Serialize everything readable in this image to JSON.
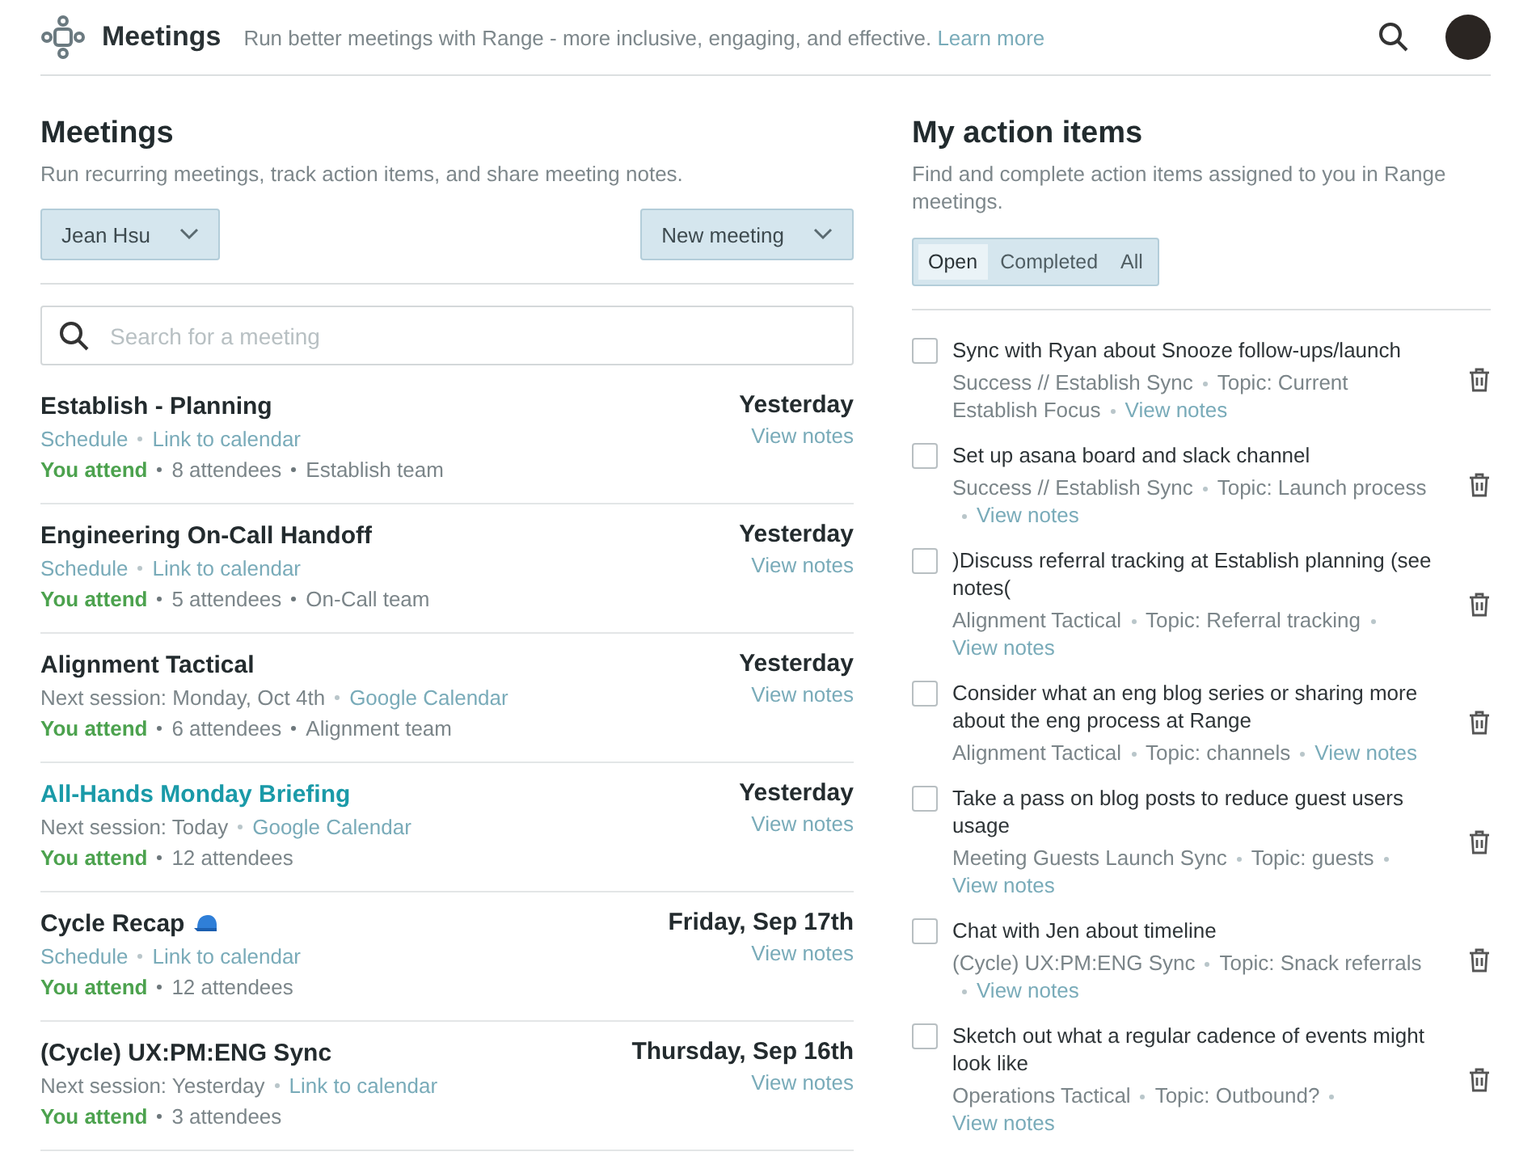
{
  "header": {
    "title": "Meetings",
    "tagline": "Run better meetings with Range - more inclusive, engaging, and effective.",
    "learn_more": "Learn more"
  },
  "meetings_panel": {
    "title": "Meetings",
    "subtitle": "Run recurring meetings, track action items, and share meeting notes.",
    "person_dropdown": "Jean Hsu",
    "new_meeting_dropdown": "New meeting",
    "search": {
      "placeholder": "Search for a meeting"
    },
    "meetings": [
      {
        "title": "Establish - Planning",
        "kind": "standard",
        "highlighted": false,
        "date": "Yesterday",
        "view_notes": "View notes",
        "schedule": [
          {
            "text": "Schedule",
            "kind": "link"
          },
          {
            "text": "Link to calendar",
            "kind": "link"
          }
        ],
        "attend": "You attend",
        "details": [
          "8 attendees",
          "Establish team"
        ]
      },
      {
        "title": "Engineering On-Call Handoff",
        "kind": "standard",
        "highlighted": false,
        "date": "Yesterday",
        "view_notes": "View notes",
        "schedule": [
          {
            "text": "Schedule",
            "kind": "link"
          },
          {
            "text": "Link to calendar",
            "kind": "link"
          }
        ],
        "attend": "You attend",
        "details": [
          "5 attendees",
          "On-Call team"
        ]
      },
      {
        "title": "Alignment Tactical",
        "kind": "standard",
        "highlighted": false,
        "date": "Yesterday",
        "view_notes": "View notes",
        "schedule": [
          {
            "text": "Next session: Monday, Oct 4th",
            "kind": "plain"
          },
          {
            "text": "Google Calendar",
            "kind": "link"
          }
        ],
        "attend": "You attend",
        "details": [
          "6 attendees",
          "Alignment team"
        ]
      },
      {
        "title": "All-Hands Monday Briefing",
        "kind": "standard",
        "highlighted": true,
        "date": "Yesterday",
        "view_notes": "View notes",
        "schedule": [
          {
            "text": "Next session: Today",
            "kind": "plain"
          },
          {
            "text": "Google Calendar",
            "kind": "link"
          }
        ],
        "attend": "You attend",
        "details": [
          "12 attendees"
        ]
      },
      {
        "title": "Cycle Recap",
        "kind": "with_cap",
        "highlighted": false,
        "date": "Friday, Sep 17th",
        "view_notes": "View notes",
        "schedule": [
          {
            "text": "Schedule",
            "kind": "link"
          },
          {
            "text": "Link to calendar",
            "kind": "link"
          }
        ],
        "attend": "You attend",
        "details": [
          "12 attendees"
        ]
      },
      {
        "title": "(Cycle) UX:PM:ENG Sync",
        "kind": "standard",
        "highlighted": false,
        "date": "Thursday, Sep 16th",
        "view_notes": "View notes",
        "schedule": [
          {
            "text": "Next session: Yesterday",
            "kind": "plain"
          },
          {
            "text": "Link to calendar",
            "kind": "link"
          }
        ],
        "attend": "You attend",
        "details": [
          "3 attendees"
        ]
      }
    ]
  },
  "action_items_panel": {
    "title": "My action items",
    "subtitle": "Find and complete action items assigned to you in Range meetings.",
    "tabs": [
      {
        "label": "Open",
        "selected": true
      },
      {
        "label": "Completed",
        "selected": false
      },
      {
        "label": "All",
        "selected": false
      }
    ],
    "items": [
      {
        "text": "Sync with Ryan about Snooze follow-ups/launch",
        "checked": false,
        "meeting": "Success // Establish Sync",
        "topic": "Topic: Current Establish Focus",
        "view_notes": "View notes"
      },
      {
        "text": "Set up asana board and slack channel",
        "checked": false,
        "meeting": "Success // Establish Sync",
        "topic": "Topic: Launch process",
        "view_notes": "View notes"
      },
      {
        "text": ")Discuss referral tracking at Establish planning (see notes(",
        "checked": false,
        "meeting": "Alignment Tactical",
        "topic": "Topic: Referral tracking",
        "view_notes": "View notes"
      },
      {
        "text": "Consider what an eng blog series or sharing more about the eng process at Range",
        "checked": false,
        "meeting": "Alignment Tactical",
        "topic": "Topic: channels",
        "view_notes": "View notes"
      },
      {
        "text": "Take a pass on blog posts to reduce guest users usage",
        "checked": false,
        "meeting": "Meeting Guests Launch Sync",
        "topic": "Topic: guests",
        "view_notes": "View notes"
      },
      {
        "text": "Chat with Jen about timeline",
        "checked": false,
        "meeting": "(Cycle) UX:PM:ENG Sync",
        "topic": "Topic: Snack referrals",
        "view_notes": "View notes"
      },
      {
        "text": "Sketch out what a regular cadence of events might look like",
        "checked": false,
        "meeting": "Operations Tactical",
        "topic": "Topic: Outbound?",
        "view_notes": "View notes"
      }
    ]
  }
}
